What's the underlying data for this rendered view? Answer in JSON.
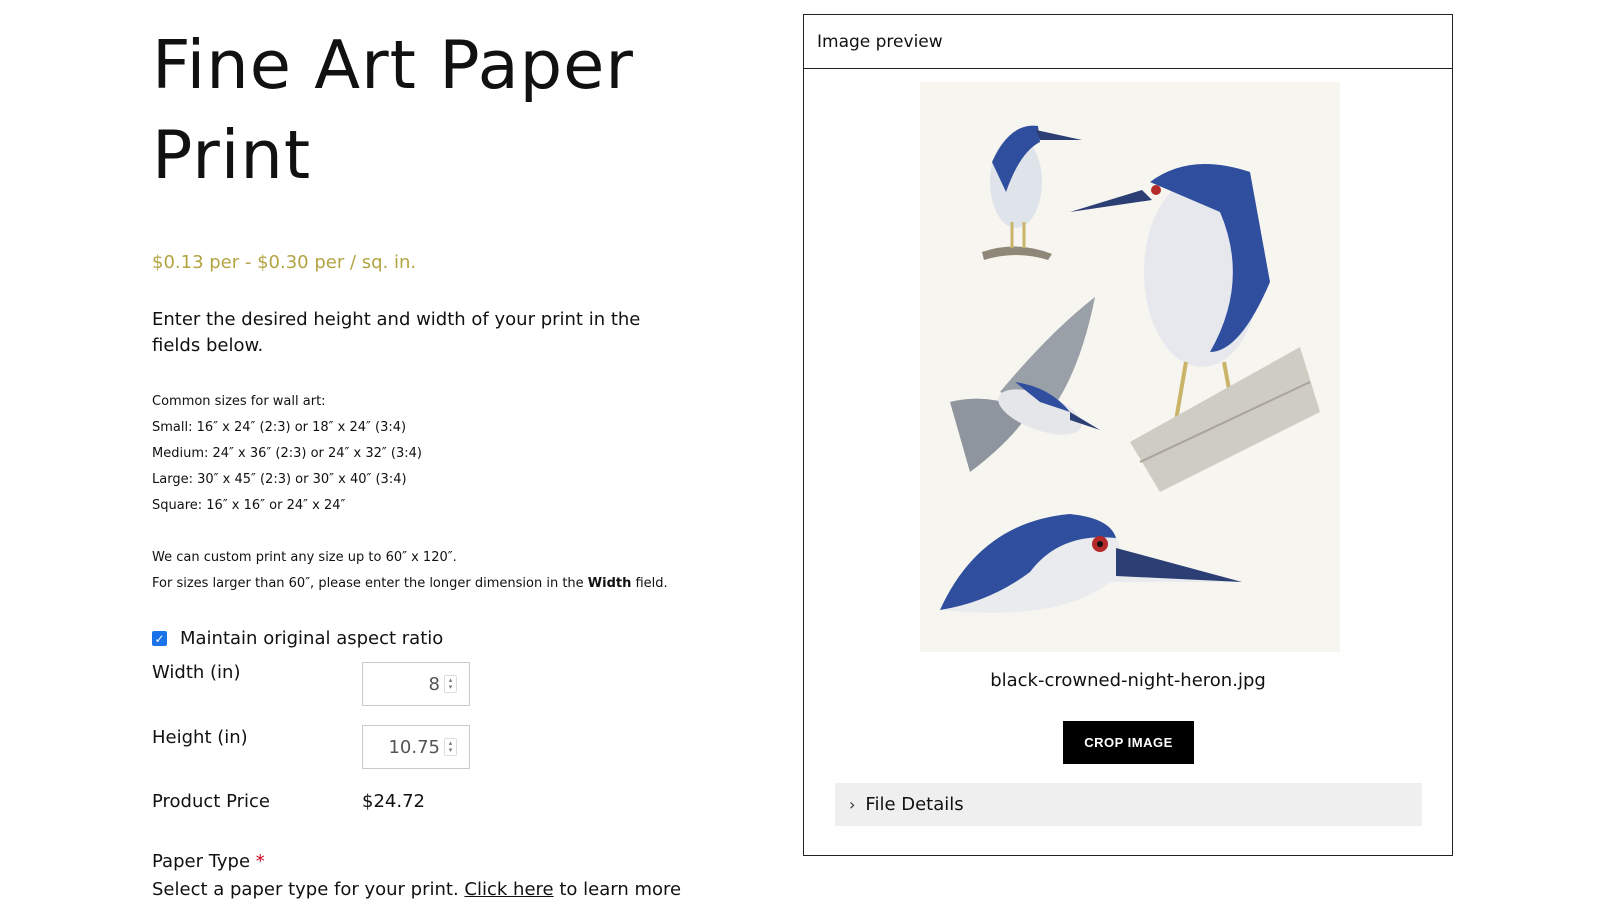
{
  "product": {
    "title_line1": "Fine Art Paper",
    "title_line2": "Print",
    "price_range": "$0.13 per - $0.30 per / sq. in.",
    "intro": "Enter the desired height and width of your print in the fields below.",
    "sizes": [
      "Common sizes for wall art:",
      "Small: 16″ x 24″ (2:3) or 18″ x 24″ (3:4)",
      "Medium: 24″ x 36″ (2:3) or 24″ x 32″ (3:4)",
      "Large: 30″ x 45″ (2:3) or 30″ x 40″ (3:4)",
      "Square: 16″ x 16″ or 24″ x 24″"
    ],
    "custom_line1": "We can custom print any size up to 60″ x 120″.",
    "custom_line2_pre": "For sizes larger than 60″, please enter the longer dimension in the ",
    "custom_line2_bold": "Width",
    "custom_line2_post": " field."
  },
  "form": {
    "aspect_ratio_label": "Maintain original aspect ratio",
    "aspect_ratio_checked": true,
    "width_label": "Width (in)",
    "width_value": "8",
    "height_label": "Height (in)",
    "height_value": "10.75",
    "price_label": "Product Price",
    "price_value": "$24.72",
    "paper_type_label": "Paper Type",
    "required_mark": "*",
    "paper_desc_pre": "Select a paper type for your print. ",
    "paper_desc_link": "Click here",
    "paper_desc_post": " to learn more"
  },
  "preview": {
    "header": "Image preview",
    "filename": "black-crowned-night-heron.jpg",
    "crop_button": "CROP IMAGE",
    "file_details": "File Details"
  },
  "colors": {
    "price_accent": "#b3a443",
    "checkbox": "#1a73e8",
    "heron_blue": "#2f4f9e",
    "required": "#d0021b"
  }
}
